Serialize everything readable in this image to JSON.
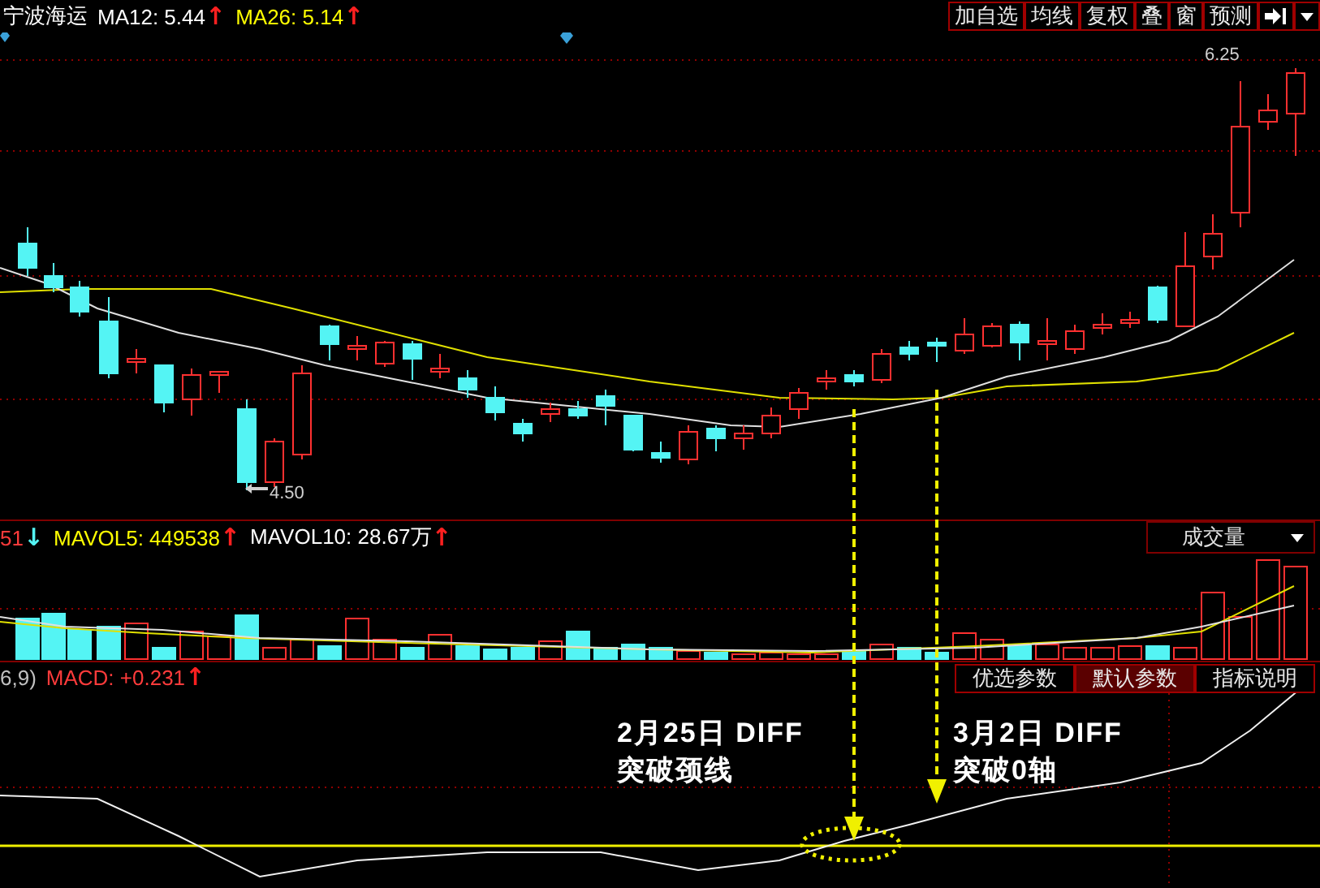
{
  "header": {
    "stock_name": "宁波海运",
    "indicators": [
      {
        "text": "MA12: 5.44",
        "color": "#ffffff",
        "arrow": {
          "text": "↑",
          "color": "#ff2020"
        }
      },
      {
        "text": "MA26: 5.14",
        "color": "#ffff00",
        "arrow": {
          "text": "↑",
          "color": "#ff2020"
        }
      }
    ],
    "buttons": [
      "加自选",
      "均线",
      "复权",
      "叠",
      "窗",
      "预测"
    ]
  },
  "price_chart": {
    "high_label": "6.25",
    "low_label": "4.50"
  },
  "volume_panel": {
    "indicators": [
      {
        "text": "51",
        "color": "#ff3b3b",
        "arrow": {
          "text": "↓",
          "color": "#54f4f4"
        }
      },
      {
        "text": "MAVOL5: 449538",
        "color": "#ffff00",
        "arrow": {
          "text": "↑",
          "color": "#ff2020"
        }
      },
      {
        "text": "MAVOL10: 28.67万",
        "color": "#ffffff",
        "arrow": {
          "text": "↑",
          "color": "#ff2020"
        }
      }
    ],
    "selector": "成交量"
  },
  "macd_panel": {
    "indicators": [
      {
        "text": "6,9)",
        "color": "#c0c0c0"
      },
      {
        "text": "MACD: +0.231",
        "color": "#ff3b3b",
        "arrow": {
          "text": "↑",
          "color": "#ff2020"
        }
      }
    ],
    "tabs": [
      {
        "label": "优选参数",
        "selected": false
      },
      {
        "label": "默认参数",
        "selected": true
      },
      {
        "label": "指标说明",
        "selected": false
      }
    ],
    "annotations": [
      {
        "text": "2月25日 DIFF\n突破颈线"
      },
      {
        "text": "3月2日 DIFF\n突破0轴"
      }
    ]
  }
}
